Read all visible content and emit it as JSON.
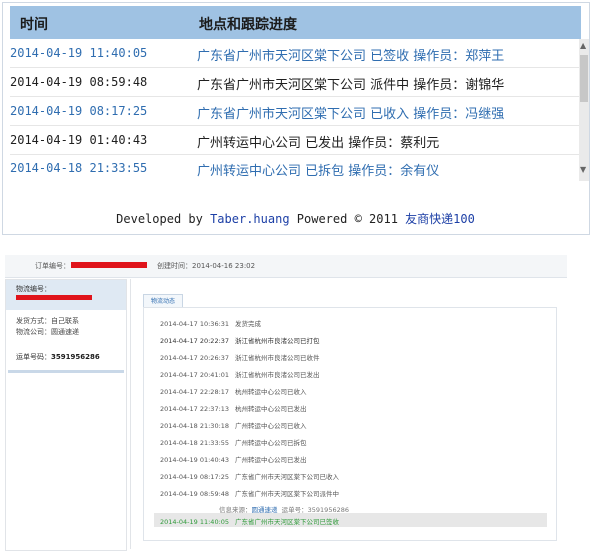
{
  "tracking": {
    "col_time": "时间",
    "col_location": "地点和跟踪进度",
    "rows": [
      {
        "time": "2014-04-19 11:40:05",
        "detail": "广东省广州市天河区棠下公司 已签收 操作员：郑萍王",
        "color": "#2f6db0"
      },
      {
        "time": "2014-04-19 08:59:48",
        "detail": "广东省广州市天河区棠下公司 派件中 操作员：谢锦华",
        "color": "#1f1f1f"
      },
      {
        "time": "2014-04-19 08:17:25",
        "detail": "广东省广州市天河区棠下公司 已收入 操作员：冯继强",
        "color": "#2f6db0"
      },
      {
        "time": "2014-04-19 01:40:43",
        "detail": "广州转运中心公司 已发出 操作员：蔡利元",
        "color": "#1f1f1f"
      },
      {
        "time": "2014-04-18 21:33:55",
        "detail": "广州转运中心公司 已拆包 操作员：余有仪",
        "color": "#2f6db0"
      }
    ],
    "footer_prefix": "Developed by ",
    "footer_author": "Taber.huang",
    "footer_mid": " Powered © 2011 ",
    "footer_brand": "友商快递100"
  },
  "order": {
    "order_no_label": "订单编号：",
    "created_label": "创建时间：",
    "created_value": "2014-04-16 23:02",
    "logistics_no_label": "物流编号：",
    "ship_method": "发货方式：自己联系",
    "logistics_company": "物流公司：圆通速递",
    "waybill_label": "运单号码：",
    "waybill_value": "3591956286",
    "tab_label": "物流动态",
    "events": [
      {
        "time": "2014-04-17 10:36:31",
        "text": "发货完成"
      },
      {
        "time": "2014-04-17 20:22:37",
        "text": "浙江省杭州市良渚公司已打包"
      },
      {
        "time": "2014-04-17 20:26:37",
        "text": "浙江省杭州市良渚公司已收件"
      },
      {
        "time": "2014-04-17 20:41:01",
        "text": "浙江省杭州市良渚公司已发出"
      },
      {
        "time": "2014-04-17 22:28:17",
        "text": "杭州转运中心公司已收入"
      },
      {
        "time": "2014-04-17 22:37:13",
        "text": "杭州转运中心公司已发出"
      },
      {
        "time": "2014-04-18 21:30:18",
        "text": "广州转运中心公司已收入"
      },
      {
        "time": "2014-04-18 21:33:55",
        "text": "广州转运中心公司已拆包"
      },
      {
        "time": "2014-04-19 01:40:43",
        "text": "广州转运中心公司已发出"
      },
      {
        "time": "2014-04-19 08:17:25",
        "text": "广东省广州市天河区棠下公司已收入"
      },
      {
        "time": "2014-04-19 08:59:48",
        "text": "广东省广州市天河区棠下公司派件中"
      },
      {
        "time": "2014-04-19 11:40:05",
        "text": "广东省广州市天河区棠下公司已签收"
      }
    ],
    "source_label": "信息来源：",
    "source_value": "圆通速递",
    "source_waybill_label": "运单号：",
    "source_waybill_value": "3591956286"
  }
}
